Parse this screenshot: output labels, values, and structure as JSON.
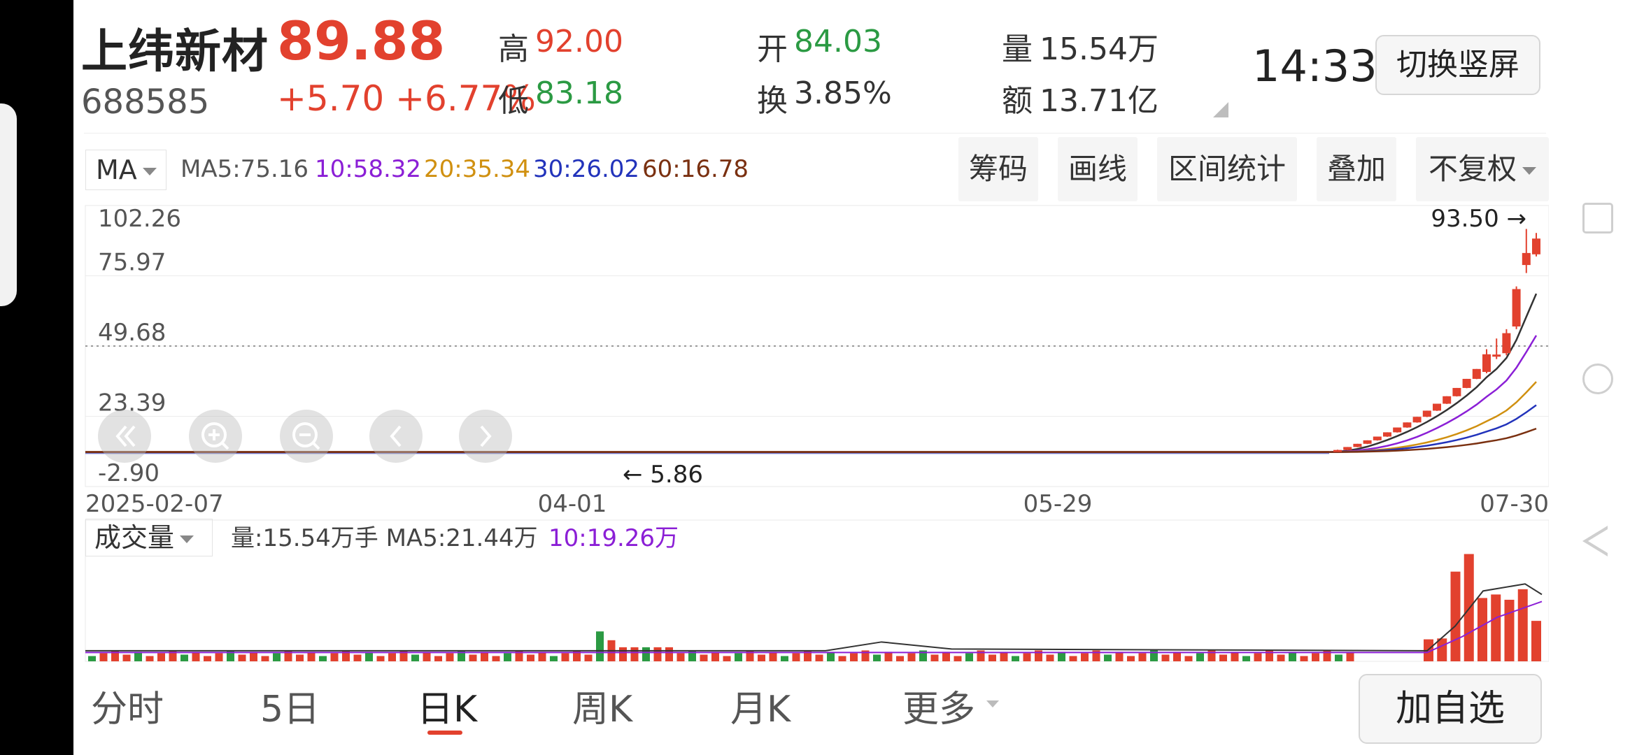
{
  "header": {
    "stock_name": "上纬新材",
    "price": "89.88",
    "code": "688585",
    "change": "+5.70 +6.77%",
    "high_label": "高",
    "high_value": "92.00",
    "low_label": "低",
    "low_value": "83.18",
    "open_label": "开",
    "open_value": "84.03",
    "turnover_label": "换",
    "turnover_value": "3.85%",
    "volume_label": "量",
    "volume_value": "15.54万",
    "amount_label": "额",
    "amount_value": "13.71亿",
    "time": "14:33",
    "switch_button": "切换竖屏"
  },
  "colors": {
    "up": "#e2412e",
    "down": "#2b9a43",
    "ma5": "#333333",
    "ma10": "#8b1fd6",
    "ma20": "#d09010",
    "ma30": "#2233bb",
    "ma60": "#7a3010"
  },
  "indicator_bar": {
    "selector": "MA",
    "ma5": "MA5:75.16",
    "ma10": "10:58.32",
    "ma20": "20:35.34",
    "ma30": "30:26.02",
    "ma60": "60:16.78"
  },
  "toolbar": {
    "chips": "筹码",
    "draw": "画线",
    "range_stats": "区间统计",
    "overlay": "叠加",
    "adjust": "不复权"
  },
  "volume_bar": {
    "selector": "成交量",
    "summary": "量:15.54万手 MA5:21.44万",
    "ma10": "10:19.26万"
  },
  "period_tabs": [
    "分时",
    "5日",
    "日K",
    "周K",
    "月K",
    "更多"
  ],
  "active_tab": "日K",
  "add_button": "加自选",
  "icons": [
    "scroll-left-icon",
    "zoom-in-icon",
    "zoom-out-icon",
    "prev-icon",
    "next-icon",
    "nav-square-icon",
    "nav-circle-icon",
    "nav-back-icon"
  ],
  "chart_data": {
    "type": "candlestick",
    "y_axis_labels": [
      "102.26",
      "75.97",
      "49.68",
      "23.39",
      "-2.90"
    ],
    "ylim": [
      -2.9,
      102.26
    ],
    "x_axis_labels": [
      "2025-02-07",
      "04-01",
      "05-29",
      "07-30"
    ],
    "reference_line": 49.68,
    "max_annotation": "93.50 →",
    "min_annotation": "← 5.86",
    "recent_candles": [
      {
        "open": 10.2,
        "close": 10.8,
        "high": 10.9,
        "low": 10.1
      },
      {
        "open": 10.8,
        "close": 11.9,
        "high": 11.9,
        "low": 10.7
      },
      {
        "open": 11.9,
        "close": 13.1,
        "high": 13.1,
        "low": 11.8
      },
      {
        "open": 13.1,
        "close": 14.4,
        "high": 14.4,
        "low": 13.0
      },
      {
        "open": 14.4,
        "close": 15.8,
        "high": 15.8,
        "low": 14.3
      },
      {
        "open": 15.8,
        "close": 17.4,
        "high": 17.4,
        "low": 15.7
      },
      {
        "open": 17.4,
        "close": 19.2,
        "high": 19.2,
        "low": 17.3
      },
      {
        "open": 19.2,
        "close": 21.1,
        "high": 21.1,
        "low": 19.1
      },
      {
        "open": 21.1,
        "close": 23.2,
        "high": 23.2,
        "low": 21.0
      },
      {
        "open": 23.2,
        "close": 25.5,
        "high": 25.5,
        "low": 23.1
      },
      {
        "open": 25.5,
        "close": 28.1,
        "high": 28.1,
        "low": 25.4
      },
      {
        "open": 28.1,
        "close": 30.9,
        "high": 30.9,
        "low": 28.0
      },
      {
        "open": 30.9,
        "close": 34.0,
        "high": 34.0,
        "low": 30.8
      },
      {
        "open": 34.0,
        "close": 37.4,
        "high": 37.4,
        "low": 33.9
      },
      {
        "open": 37.4,
        "close": 41.1,
        "high": 41.1,
        "low": 37.3
      },
      {
        "open": 40.0,
        "close": 46.6,
        "high": 48.5,
        "low": 39.5
      },
      {
        "open": 45.7,
        "close": 46.5,
        "high": 52.5,
        "low": 44.8
      },
      {
        "open": 47.0,
        "close": 54.5,
        "high": 56.0,
        "low": 46.2
      },
      {
        "open": 57.0,
        "close": 71.0,
        "high": 72.0,
        "low": 56.0
      },
      {
        "open": 80.0,
        "close": 84.5,
        "high": 93.5,
        "low": 77.0
      },
      {
        "open": 84.0,
        "close": 89.9,
        "high": 92.0,
        "low": 83.2
      }
    ],
    "volume_highlights": [
      {
        "value": 12.5,
        "dir": "up"
      },
      {
        "value": 13.0,
        "dir": "up"
      },
      {
        "value": 51.0,
        "dir": "up"
      },
      {
        "value": 61.0,
        "dir": "up"
      },
      {
        "value": 36.0,
        "dir": "up"
      },
      {
        "value": 38.0,
        "dir": "up"
      },
      {
        "value": 35.0,
        "dir": "up"
      },
      {
        "value": 41.0,
        "dir": "up"
      },
      {
        "value": 23.0,
        "dir": "up"
      }
    ],
    "volume_ylim": [
      0,
      62
    ]
  }
}
